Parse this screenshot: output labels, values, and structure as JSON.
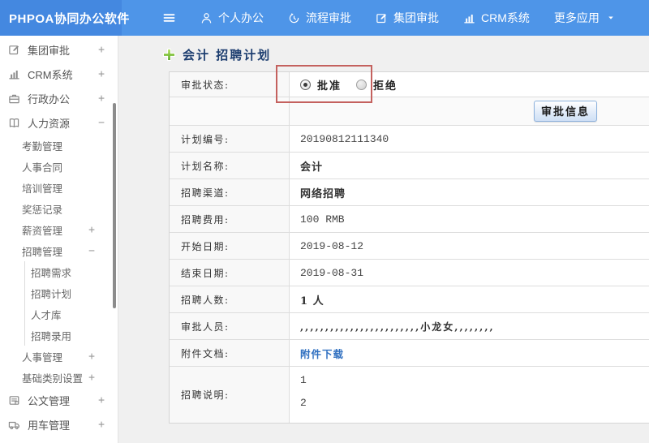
{
  "app_title": "PHPOA协同办公软件",
  "topnav": {
    "items": [
      {
        "label": "个人办公",
        "icon": "person-icon"
      },
      {
        "label": "流程审批",
        "icon": "flow-icon"
      },
      {
        "label": "集团审批",
        "icon": "edit-square-icon"
      },
      {
        "label": "CRM系统",
        "icon": "chart-icon"
      },
      {
        "label": "更多应用",
        "icon": "",
        "caret": true
      }
    ]
  },
  "sidebar": {
    "items": [
      {
        "label": "集团审批",
        "icon": "edit-square-icon",
        "level": 1,
        "expander": "+"
      },
      {
        "label": "CRM系统",
        "icon": "chart-icon",
        "level": 1,
        "expander": "+"
      },
      {
        "label": "行政办公",
        "icon": "briefcase-icon",
        "level": 1,
        "expander": "+"
      },
      {
        "label": "人力资源",
        "icon": "book-icon",
        "level": 1,
        "expander": "−"
      },
      {
        "label": "考勤管理",
        "level": 2,
        "expander": ""
      },
      {
        "label": "人事合同",
        "level": 2,
        "expander": ""
      },
      {
        "label": "培训管理",
        "level": 2,
        "expander": ""
      },
      {
        "label": "奖惩记录",
        "level": 2,
        "expander": ""
      },
      {
        "label": "薪资管理",
        "level": 2,
        "expander": "+"
      },
      {
        "label": "招聘管理",
        "level": 2,
        "expander": "−"
      },
      {
        "label": "招聘需求",
        "level": 3,
        "expander": ""
      },
      {
        "label": "招聘计划",
        "level": 3,
        "expander": ""
      },
      {
        "label": "人才库",
        "level": 3,
        "expander": ""
      },
      {
        "label": "招聘录用",
        "level": 3,
        "expander": ""
      },
      {
        "label": "人事管理",
        "level": 2,
        "expander": "+"
      },
      {
        "label": "基础类别设置",
        "level": 2,
        "expander": "+"
      },
      {
        "label": "公文管理",
        "icon": "doc-icon",
        "level": 1,
        "expander": "+"
      },
      {
        "label": "用车管理",
        "icon": "truck-icon",
        "level": 1,
        "expander": "+"
      }
    ]
  },
  "main": {
    "page_title": "会计 招聘计划",
    "approval": {
      "label": "审批状态:",
      "options": [
        {
          "label": "批准",
          "selected": true
        },
        {
          "label": "拒绝",
          "selected": false
        }
      ],
      "info_button": "审批信息"
    },
    "fields": [
      {
        "label": "计划编号:",
        "value": "20190812111340",
        "style": "mono"
      },
      {
        "label": "计划名称:",
        "value": "会计",
        "style": "cjk"
      },
      {
        "label": "招聘渠道:",
        "value": "网络招聘",
        "style": "cjk"
      },
      {
        "label": "招聘费用:",
        "value": "100 RMB",
        "style": "mono"
      },
      {
        "label": "开始日期:",
        "value": "2019-08-12",
        "style": "mono"
      },
      {
        "label": "结束日期:",
        "value": "2019-08-31",
        "style": "mono"
      },
      {
        "label": "招聘人数:",
        "value": "1 人",
        "style": "cjk"
      },
      {
        "label": "审批人员:",
        "value": ",,,,,,,,,,,,,,,,,,,,,,,,小龙女,,,,,,,,",
        "style": "cjk-small"
      },
      {
        "label": "附件文档:",
        "value": "附件下载",
        "style": "link"
      },
      {
        "label": "招聘说明:",
        "value": "",
        "lines": [
          "1",
          "2"
        ],
        "style": "multiline"
      }
    ]
  },
  "colors": {
    "topbar": "#4e95e8",
    "logo_bg": "#4488e0",
    "annotation_red": "#c4615e",
    "link_blue": "#2f6fc0",
    "title_navy": "#1c3d6f"
  }
}
